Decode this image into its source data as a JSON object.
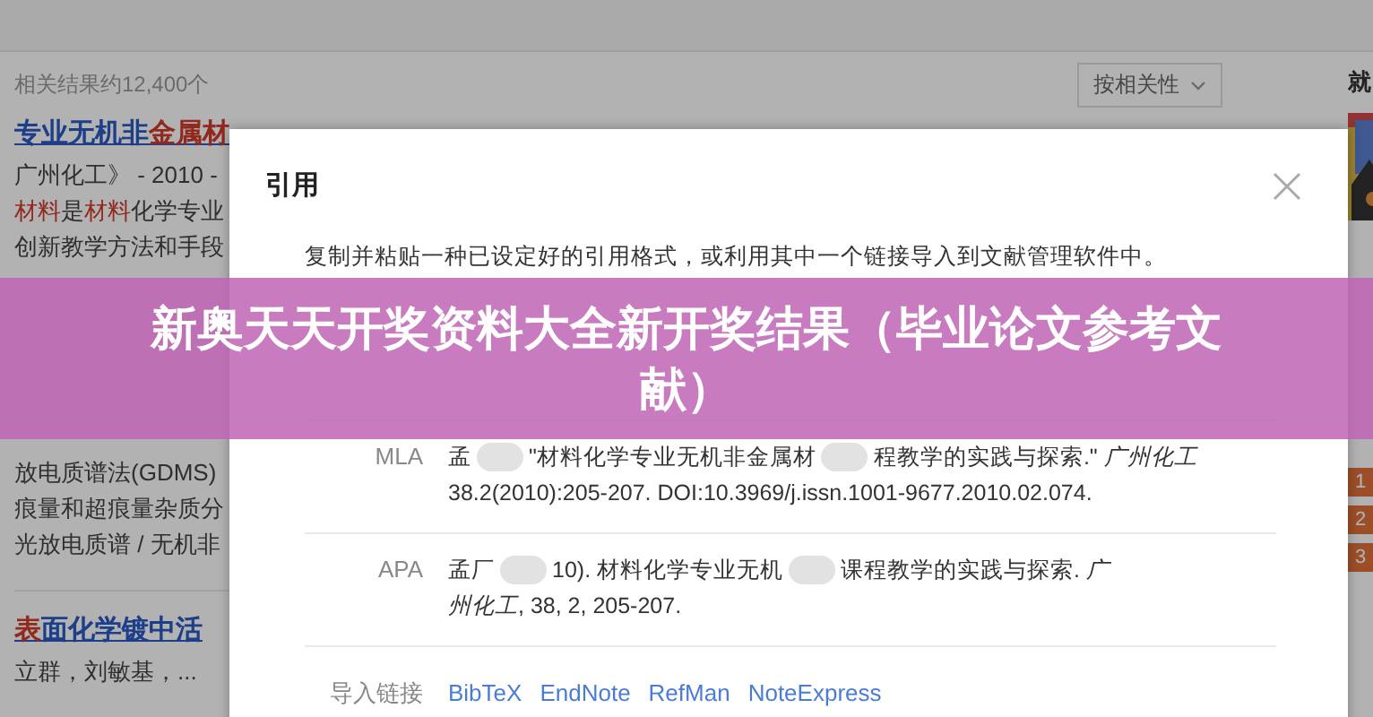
{
  "background_page": {
    "result_count": "相关结果约12,400个",
    "sort_dropdown": {
      "label": "按相关性"
    },
    "results": [
      {
        "title": "专业无机非**金属材**",
        "lines": [
          "广州化工》 - 2010 -",
          "**材料**是**材料**化学专业",
          "创新教学方法和手段"
        ]
      },
      {
        "lines": [
          "放电质谱法(GDMS)",
          "痕量和超痕量杂质分",
          "光放电质谱 / 无机非"
        ]
      },
      {
        "title": "**表**面化学镀中活",
        "lines": [
          "立群，刘敏基，..."
        ]
      }
    ],
    "side_heading": "就",
    "ranks": [
      "1",
      "2",
      "3"
    ]
  },
  "dialog": {
    "title": "引用",
    "description": "复制并粘贴一种已设定好的引用格式，或利用其中一个链接导入到文献管理软件中。",
    "citations": [
      {
        "style": "MLA",
        "parts": [
          {
            "kind": "text",
            "text": "孟"
          },
          {
            "kind": "blur"
          },
          {
            "kind": "text",
            "text": "\"材料化学专业无机非金属材"
          },
          {
            "kind": "blur"
          },
          {
            "kind": "text",
            "text": "程教学的实践与探索.\" *广州化工*"
          },
          {
            "kind": "text",
            "text": "38.2(2010):205-207. DOI:10.3969/j.issn.1001-9677.2010.02.074."
          }
        ]
      },
      {
        "style": "APA",
        "parts": [
          {
            "kind": "text",
            "text": "孟厂"
          },
          {
            "kind": "blur"
          },
          {
            "kind": "text",
            "text": "10). 材料化学专业无机"
          },
          {
            "kind": "blur"
          },
          {
            "kind": "text",
            "text": "课程教学的实践与探索. *广*"
          },
          {
            "kind": "text",
            "text": "*州化工*, 38, 2, 205-207."
          }
        ]
      }
    ],
    "import": {
      "label": "导入链接",
      "links": [
        "BibTeX",
        "EndNote",
        "RefMan",
        "NoteExpress"
      ]
    }
  },
  "banner": {
    "text": "新奥天天开奖资料大全新开奖结果（毕业论文参考文献）"
  }
}
